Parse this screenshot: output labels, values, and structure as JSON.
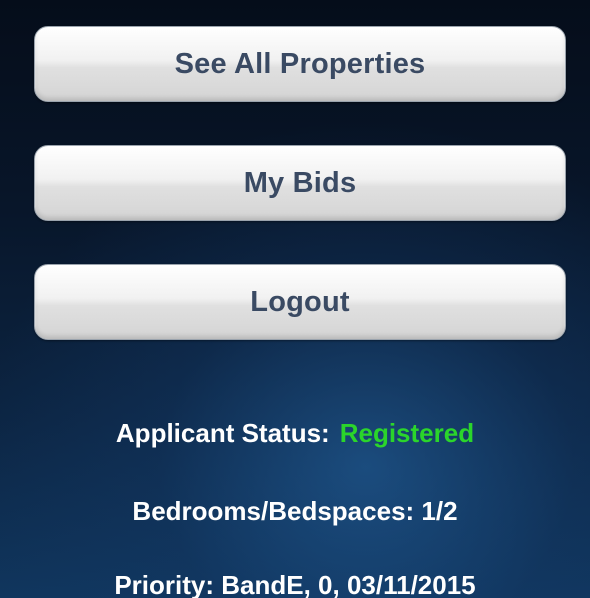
{
  "menu": {
    "see_all_properties": "See All Properties",
    "my_bids": "My Bids",
    "logout": "Logout"
  },
  "applicant": {
    "status_label": "Applicant Status:",
    "status_value": "Registered",
    "status_color": "#2bd52b",
    "bedrooms": "Bedrooms/Bedspaces: 1/2",
    "priority": "Priority: BandE, 0, 03/11/2015"
  }
}
